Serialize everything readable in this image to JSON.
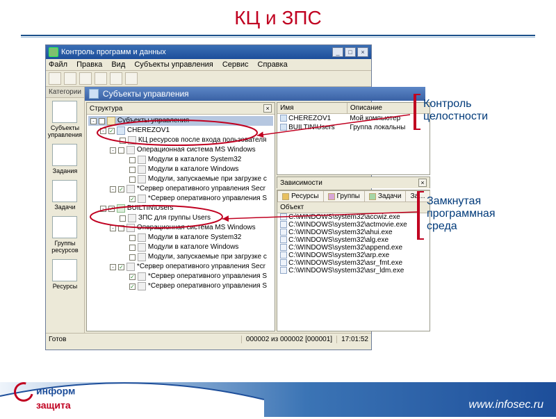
{
  "slide": {
    "title": "КЦ и ЗПС"
  },
  "callouts": {
    "integrity": "Контроль\nцелостности",
    "closed_env": "Замкнутая\nпрограммная\nсреда"
  },
  "app": {
    "title": "Контроль программ и данных",
    "menu": [
      "Файл",
      "Правка",
      "Вид",
      "Субъекты управления",
      "Сервис",
      "Справка"
    ],
    "sidebar_header": "Категории",
    "sidebar_items": [
      "Субъекты управления",
      "Задания",
      "Задачи",
      "Группы ресурсов",
      "Ресурсы"
    ],
    "panel_title": "Субъекты управления",
    "tree_header": "Структура",
    "tree": [
      {
        "ind": 0,
        "tw": "-",
        "chk": "",
        "icon": "fld",
        "label": "Субъекты управления",
        "sel": true
      },
      {
        "ind": 1,
        "tw": "-",
        "chk": "✓",
        "icon": "pc",
        "label": "CHEREZOV1"
      },
      {
        "ind": 2,
        "tw": "",
        "chk": "",
        "icon": "sys",
        "label": "КЦ ресурсов после входа пользователя"
      },
      {
        "ind": 2,
        "tw": "-",
        "chk": "",
        "icon": "sys",
        "label": "Операционная система MS Windows"
      },
      {
        "ind": 3,
        "tw": "",
        "chk": "",
        "icon": "sys",
        "label": "Модули в каталоге System32"
      },
      {
        "ind": 3,
        "tw": "",
        "chk": "",
        "icon": "sys",
        "label": "Модули в каталоге Windows"
      },
      {
        "ind": 3,
        "tw": "",
        "chk": "",
        "icon": "sys",
        "label": "Модули, запускаемые при загрузке с"
      },
      {
        "ind": 2,
        "tw": "-",
        "chk": "✓",
        "icon": "sys",
        "label": "*Сервер оперативного управления Secr"
      },
      {
        "ind": 3,
        "tw": "",
        "chk": "✓",
        "icon": "sys",
        "label": "*Сервер оперативного управления S"
      },
      {
        "ind": 1,
        "tw": "-",
        "chk": "✓",
        "icon": "grp",
        "label": "BUILTIN\\Users"
      },
      {
        "ind": 2,
        "tw": "",
        "chk": "",
        "icon": "sys",
        "label": "ЗПС для группы Users"
      },
      {
        "ind": 2,
        "tw": "-",
        "chk": "",
        "icon": "sys",
        "label": "Операционная система MS Windows"
      },
      {
        "ind": 3,
        "tw": "",
        "chk": "",
        "icon": "sys",
        "label": "Модули в каталоге System32"
      },
      {
        "ind": 3,
        "tw": "",
        "chk": "",
        "icon": "sys",
        "label": "Модули в каталоге Windows"
      },
      {
        "ind": 3,
        "tw": "",
        "chk": "",
        "icon": "sys",
        "label": "Модули, запускаемые при загрузке с"
      },
      {
        "ind": 2,
        "tw": "-",
        "chk": "✓",
        "icon": "sys",
        "label": "*Сервер оперативного управления Secr"
      },
      {
        "ind": 3,
        "tw": "",
        "chk": "✓",
        "icon": "sys",
        "label": "*Сервер оперативного управления S"
      },
      {
        "ind": 3,
        "tw": "",
        "chk": "✓",
        "icon": "sys",
        "label": "*Сервер оперативного управления S"
      }
    ],
    "top_list": {
      "cols": [
        "Имя",
        "Описание"
      ],
      "rows": [
        {
          "name": "CHEREZOV1",
          "desc": "Мой компьютер"
        },
        {
          "name": "BUILTIN\\Users",
          "desc": "Группа локальны"
        }
      ]
    },
    "deps_header": "Зависимости",
    "tabs": [
      "Ресурсы",
      "Группы",
      "Задачи",
      "За…"
    ],
    "object_header": "Объект",
    "objects": [
      "C:\\WINDOWS\\system32\\accwiz.exe",
      "C:\\WINDOWS\\system32\\actmovie.exe",
      "C:\\WINDOWS\\system32\\ahui.exe",
      "C:\\WINDOWS\\system32\\alg.exe",
      "C:\\WINDOWS\\system32\\append.exe",
      "C:\\WINDOWS\\system32\\arp.exe",
      "C:\\WINDOWS\\system32\\asr_fmt.exe",
      "C:\\WINDOWS\\system32\\asr_ldm.exe"
    ],
    "status": {
      "left": "Готов",
      "mid": "000002 из 000002 [000001]",
      "right": "17:01:52"
    }
  },
  "footer": {
    "logo_top": "информ",
    "logo_bottom": "защита",
    "url": "www.infosec.ru"
  }
}
